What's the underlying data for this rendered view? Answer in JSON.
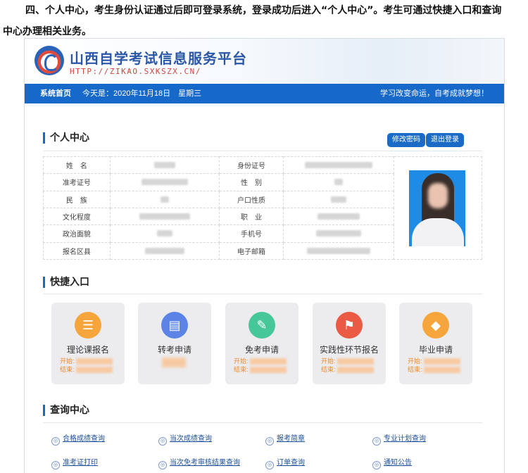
{
  "doc": {
    "line1": "四、个人中心，考生身份认证通过后即可登录系统，登录成功后进入“个人中心”。考生可通过快捷入口和查询",
    "line2": "中心办理相关业务。"
  },
  "header": {
    "title": "山西自学考试信息服务平台",
    "url": "HTTP://ZIKAO.SXKSZX.CN/"
  },
  "nav": {
    "home": "系统首页",
    "date": "今天是：2020年11月18日　星期三",
    "slogan": "学习改变命运，自考成就梦想！"
  },
  "personal": {
    "title": "个人中心",
    "edit_password": "修改密码",
    "logout": "退出登录",
    "rows": [
      {
        "l1": "姓　名",
        "l2": "身份证号"
      },
      {
        "l1": "准考证号",
        "l2": "性　别"
      },
      {
        "l1": "民　族",
        "l2": "户口性质"
      },
      {
        "l1": "文化程度",
        "l2": "职　业"
      },
      {
        "l1": "政治面貌",
        "l2": "手机号"
      },
      {
        "l1": "报名区县",
        "l2": "电子邮箱"
      }
    ]
  },
  "quick": {
    "title": "快捷入口",
    "start_label": "开始:",
    "end_label": "结束:",
    "cards": [
      {
        "label": "理论课报名",
        "icon": "layers-icon",
        "color": "#f6a53c"
      },
      {
        "label": "转考申请",
        "icon": "document-icon",
        "color": "#5b84e6"
      },
      {
        "label": "免考申请",
        "icon": "edit-icon",
        "color": "#45c79a"
      },
      {
        "label": "实践性环节报名",
        "icon": "flag-icon",
        "color": "#ea5a45"
      },
      {
        "label": "毕业申请",
        "icon": "graduation-cap-icon",
        "color": "#f6a53c"
      }
    ]
  },
  "query": {
    "title": "查询中心",
    "links": [
      "合格成绩查询",
      "当次成绩查询",
      "报考简章",
      "专业计划查询",
      "准考证打印",
      "当次免考审核结果查询",
      "订单查询",
      "通知公告"
    ]
  }
}
